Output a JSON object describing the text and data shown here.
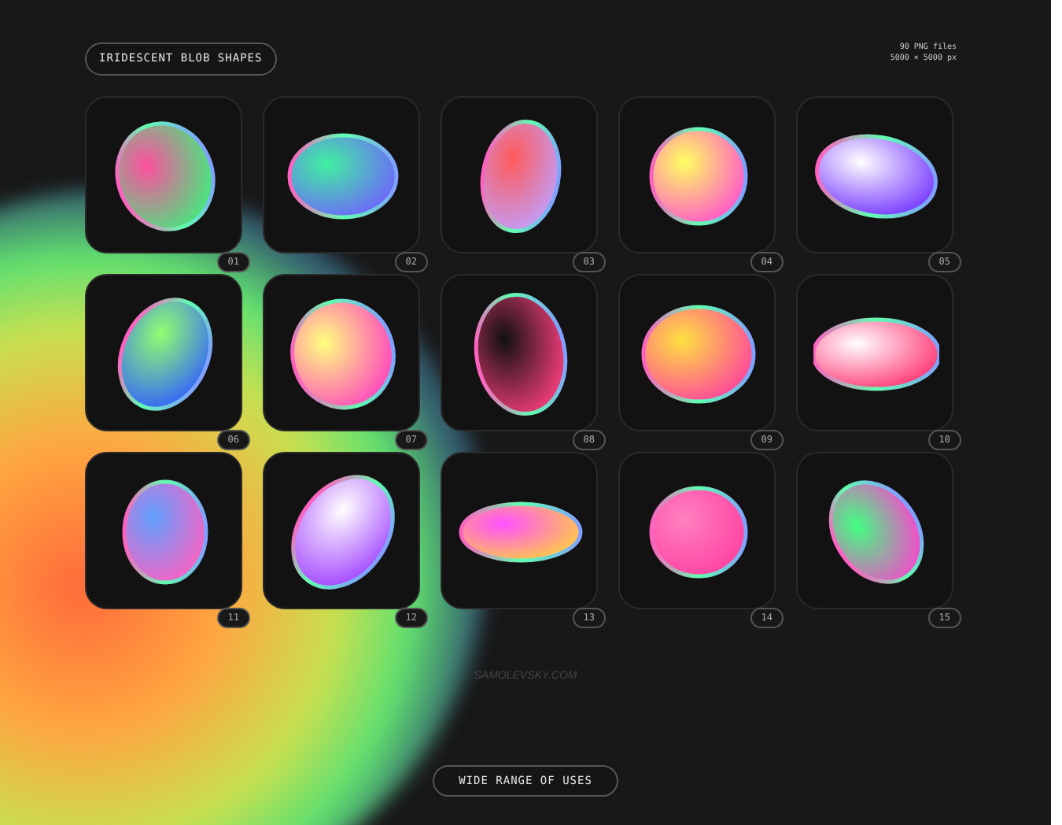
{
  "badge": {
    "label": "IRIDESCENT BLOB SHAPES"
  },
  "file_info": [
    "90 PNG files",
    "5000 × 5000 px"
  ],
  "tiles": [
    {
      "number": "01"
    },
    {
      "number": "02"
    },
    {
      "number": "03"
    },
    {
      "number": "04"
    },
    {
      "number": "05"
    },
    {
      "number": "06"
    },
    {
      "number": "07"
    },
    {
      "number": "08"
    },
    {
      "number": "09"
    },
    {
      "number": "10"
    },
    {
      "number": "11"
    },
    {
      "number": "12"
    },
    {
      "number": "13"
    },
    {
      "number": "14"
    },
    {
      "number": "15"
    }
  ],
  "site": "SAMOLEVSKY.COM",
  "footer_button": {
    "label": "WIDE RANGE OF USES"
  }
}
